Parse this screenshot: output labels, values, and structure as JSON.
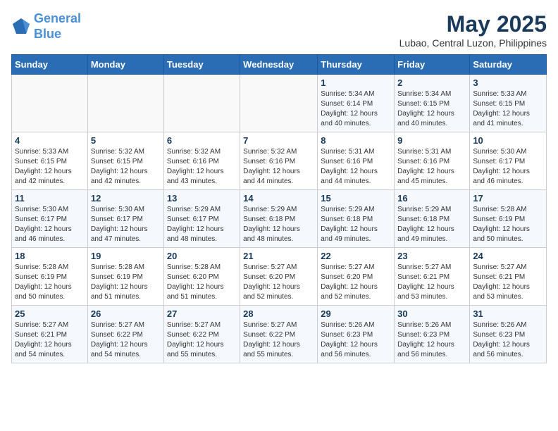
{
  "logo": {
    "line1": "General",
    "line2": "Blue"
  },
  "title": "May 2025",
  "location": "Lubao, Central Luzon, Philippines",
  "days_header": [
    "Sunday",
    "Monday",
    "Tuesday",
    "Wednesday",
    "Thursday",
    "Friday",
    "Saturday"
  ],
  "weeks": [
    [
      {
        "num": "",
        "info": ""
      },
      {
        "num": "",
        "info": ""
      },
      {
        "num": "",
        "info": ""
      },
      {
        "num": "",
        "info": ""
      },
      {
        "num": "1",
        "info": "Sunrise: 5:34 AM\nSunset: 6:14 PM\nDaylight: 12 hours\nand 40 minutes."
      },
      {
        "num": "2",
        "info": "Sunrise: 5:34 AM\nSunset: 6:15 PM\nDaylight: 12 hours\nand 40 minutes."
      },
      {
        "num": "3",
        "info": "Sunrise: 5:33 AM\nSunset: 6:15 PM\nDaylight: 12 hours\nand 41 minutes."
      }
    ],
    [
      {
        "num": "4",
        "info": "Sunrise: 5:33 AM\nSunset: 6:15 PM\nDaylight: 12 hours\nand 42 minutes."
      },
      {
        "num": "5",
        "info": "Sunrise: 5:32 AM\nSunset: 6:15 PM\nDaylight: 12 hours\nand 42 minutes."
      },
      {
        "num": "6",
        "info": "Sunrise: 5:32 AM\nSunset: 6:16 PM\nDaylight: 12 hours\nand 43 minutes."
      },
      {
        "num": "7",
        "info": "Sunrise: 5:32 AM\nSunset: 6:16 PM\nDaylight: 12 hours\nand 44 minutes."
      },
      {
        "num": "8",
        "info": "Sunrise: 5:31 AM\nSunset: 6:16 PM\nDaylight: 12 hours\nand 44 minutes."
      },
      {
        "num": "9",
        "info": "Sunrise: 5:31 AM\nSunset: 6:16 PM\nDaylight: 12 hours\nand 45 minutes."
      },
      {
        "num": "10",
        "info": "Sunrise: 5:30 AM\nSunset: 6:17 PM\nDaylight: 12 hours\nand 46 minutes."
      }
    ],
    [
      {
        "num": "11",
        "info": "Sunrise: 5:30 AM\nSunset: 6:17 PM\nDaylight: 12 hours\nand 46 minutes."
      },
      {
        "num": "12",
        "info": "Sunrise: 5:30 AM\nSunset: 6:17 PM\nDaylight: 12 hours\nand 47 minutes."
      },
      {
        "num": "13",
        "info": "Sunrise: 5:29 AM\nSunset: 6:17 PM\nDaylight: 12 hours\nand 48 minutes."
      },
      {
        "num": "14",
        "info": "Sunrise: 5:29 AM\nSunset: 6:18 PM\nDaylight: 12 hours\nand 48 minutes."
      },
      {
        "num": "15",
        "info": "Sunrise: 5:29 AM\nSunset: 6:18 PM\nDaylight: 12 hours\nand 49 minutes."
      },
      {
        "num": "16",
        "info": "Sunrise: 5:29 AM\nSunset: 6:18 PM\nDaylight: 12 hours\nand 49 minutes."
      },
      {
        "num": "17",
        "info": "Sunrise: 5:28 AM\nSunset: 6:19 PM\nDaylight: 12 hours\nand 50 minutes."
      }
    ],
    [
      {
        "num": "18",
        "info": "Sunrise: 5:28 AM\nSunset: 6:19 PM\nDaylight: 12 hours\nand 50 minutes."
      },
      {
        "num": "19",
        "info": "Sunrise: 5:28 AM\nSunset: 6:19 PM\nDaylight: 12 hours\nand 51 minutes."
      },
      {
        "num": "20",
        "info": "Sunrise: 5:28 AM\nSunset: 6:20 PM\nDaylight: 12 hours\nand 51 minutes."
      },
      {
        "num": "21",
        "info": "Sunrise: 5:27 AM\nSunset: 6:20 PM\nDaylight: 12 hours\nand 52 minutes."
      },
      {
        "num": "22",
        "info": "Sunrise: 5:27 AM\nSunset: 6:20 PM\nDaylight: 12 hours\nand 52 minutes."
      },
      {
        "num": "23",
        "info": "Sunrise: 5:27 AM\nSunset: 6:21 PM\nDaylight: 12 hours\nand 53 minutes."
      },
      {
        "num": "24",
        "info": "Sunrise: 5:27 AM\nSunset: 6:21 PM\nDaylight: 12 hours\nand 53 minutes."
      }
    ],
    [
      {
        "num": "25",
        "info": "Sunrise: 5:27 AM\nSunset: 6:21 PM\nDaylight: 12 hours\nand 54 minutes."
      },
      {
        "num": "26",
        "info": "Sunrise: 5:27 AM\nSunset: 6:22 PM\nDaylight: 12 hours\nand 54 minutes."
      },
      {
        "num": "27",
        "info": "Sunrise: 5:27 AM\nSunset: 6:22 PM\nDaylight: 12 hours\nand 55 minutes."
      },
      {
        "num": "28",
        "info": "Sunrise: 5:27 AM\nSunset: 6:22 PM\nDaylight: 12 hours\nand 55 minutes."
      },
      {
        "num": "29",
        "info": "Sunrise: 5:26 AM\nSunset: 6:23 PM\nDaylight: 12 hours\nand 56 minutes."
      },
      {
        "num": "30",
        "info": "Sunrise: 5:26 AM\nSunset: 6:23 PM\nDaylight: 12 hours\nand 56 minutes."
      },
      {
        "num": "31",
        "info": "Sunrise: 5:26 AM\nSunset: 6:23 PM\nDaylight: 12 hours\nand 56 minutes."
      }
    ]
  ]
}
